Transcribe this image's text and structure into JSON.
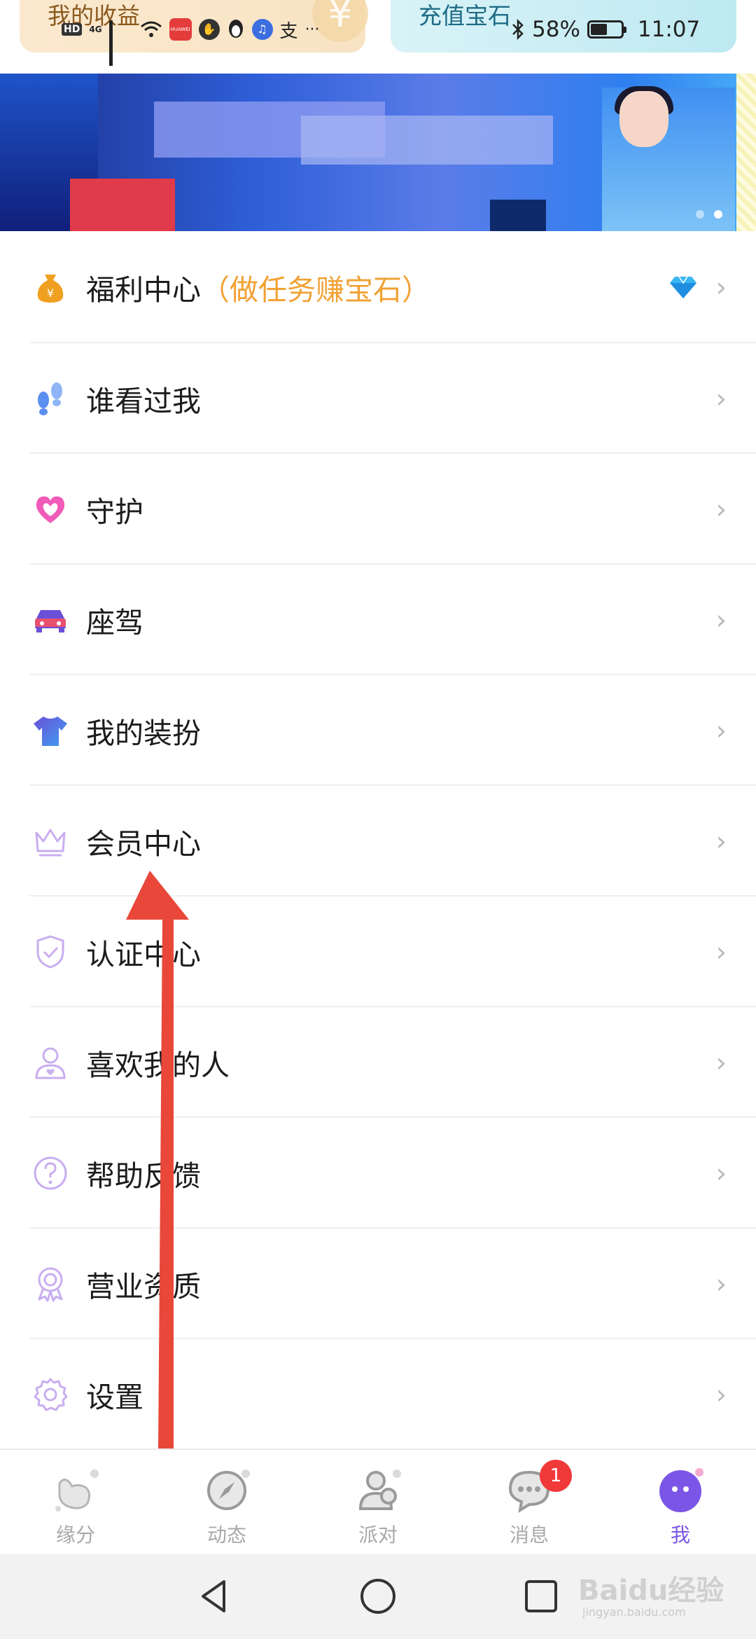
{
  "top_cards": {
    "left_title": "我的收益",
    "right_title": "充值宝石"
  },
  "status_bar": {
    "network": "4G",
    "battery": "58%",
    "battery_level": 0.58,
    "time": "11:07"
  },
  "banner": {
    "slides_total": 2,
    "active_slide": 2
  },
  "menu": {
    "items": [
      {
        "label": "福利中心",
        "sub": "（做任务赚宝石）",
        "icon": "money-bag-icon"
      },
      {
        "label": "谁看过我",
        "sub": "",
        "icon": "footprints-icon"
      },
      {
        "label": "守护",
        "sub": "",
        "icon": "heart-icon"
      },
      {
        "label": "座驾",
        "sub": "",
        "icon": "car-icon"
      },
      {
        "label": "我的装扮",
        "sub": "",
        "icon": "tshirt-icon"
      },
      {
        "label": "会员中心",
        "sub": "",
        "icon": "crown-icon"
      },
      {
        "label": "认证中心",
        "sub": "",
        "icon": "shield-check-icon"
      },
      {
        "label": "喜欢我的人",
        "sub": "",
        "icon": "person-heart-icon"
      },
      {
        "label": "帮助反馈",
        "sub": "",
        "icon": "question-icon"
      },
      {
        "label": "营业资质",
        "sub": "",
        "icon": "award-badge-icon"
      },
      {
        "label": "设置",
        "sub": "",
        "icon": "gear-icon"
      }
    ],
    "chevron": "›"
  },
  "bottom_nav": {
    "items": [
      {
        "label": "缘分",
        "icon": "fate-hand-icon"
      },
      {
        "label": "动态",
        "icon": "compass-icon"
      },
      {
        "label": "派对",
        "icon": "party-people-icon"
      },
      {
        "label": "消息",
        "icon": "chat-bubble-icon",
        "badge": "1"
      },
      {
        "label": "我",
        "icon": "me-face-icon",
        "active": true
      }
    ]
  },
  "watermark": {
    "text": "Baidu经验",
    "sub": "jingyan.baidu.com"
  },
  "colors": {
    "accent": "#7b56e6",
    "welfare_sub": "#f2a134",
    "badge": "#f03a3a",
    "arrow": "#e8473a"
  }
}
